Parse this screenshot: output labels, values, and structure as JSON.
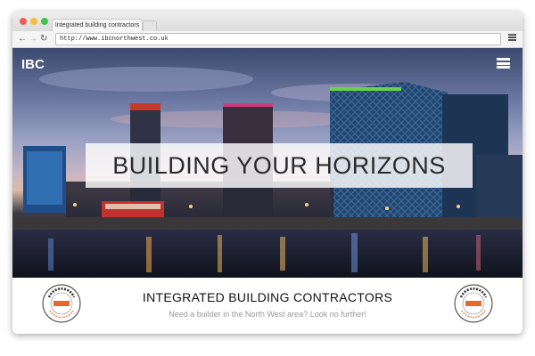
{
  "browser": {
    "tab_title": "Integrated building contractors",
    "url": "http://www.ibcnorthwest.co.uk",
    "back_icon": "←",
    "forward_icon": "→",
    "reload_icon": "↻"
  },
  "site": {
    "logo": "IBC",
    "headline": "BUILDING YOUR HORIZONS",
    "company_name": "INTEGRATED BUILDING CONTRACTORS",
    "tagline": "Need a builder in the North West area? Look no further!",
    "badge_text": "INTEGRATED BUILDING CONTRACTORS"
  },
  "colors": {
    "badge_orange": "#e8682a",
    "headline_band": "#ffffff"
  }
}
